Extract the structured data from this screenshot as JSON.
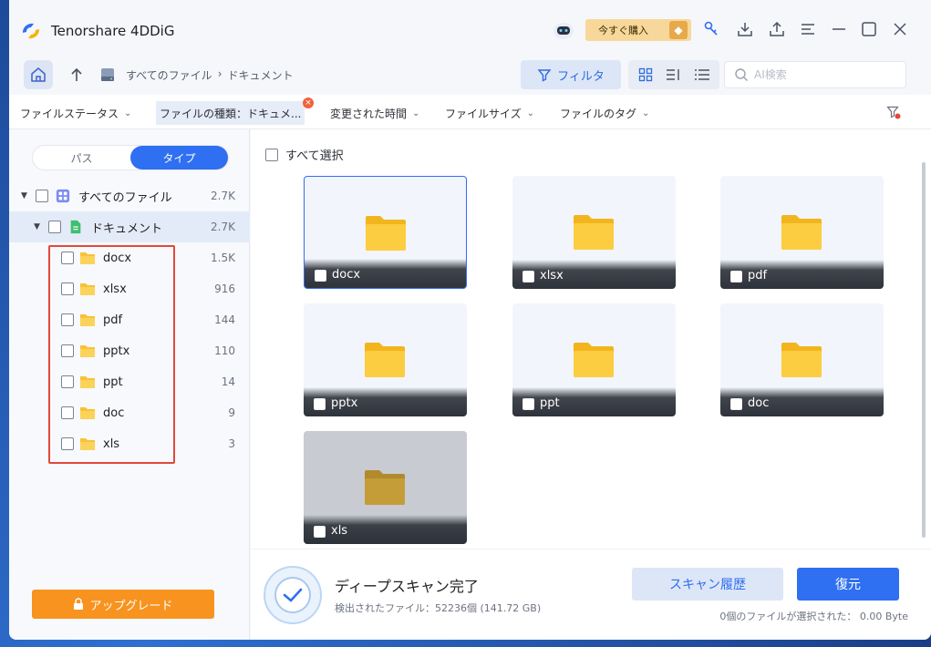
{
  "app": {
    "title": "Tenorshare 4DDiG",
    "buy_label": "今すぐ購入"
  },
  "nav": {
    "breadcrumb": [
      "すべてのファイル",
      "ドキュメント"
    ],
    "filter_label": "フィルタ",
    "search_placeholder": "AI検索"
  },
  "filters": [
    {
      "label": "ファイルステータス"
    },
    {
      "label": "ファイルの種類：ドキュメ..."
    },
    {
      "label": "変更された時間"
    },
    {
      "label": "ファイルサイズ"
    },
    {
      "label": "ファイルのタグ"
    }
  ],
  "sidebar": {
    "tabs": [
      "パス",
      "タイプ"
    ],
    "active_tab": "タイプ",
    "root": {
      "label": "すべてのファイル",
      "count": "2.7K"
    },
    "category": {
      "label": "ドキュメント",
      "count": "2.7K"
    },
    "items": [
      {
        "label": "docx",
        "count": "1.5K"
      },
      {
        "label": "xlsx",
        "count": "916"
      },
      {
        "label": "pdf",
        "count": "144"
      },
      {
        "label": "pptx",
        "count": "110"
      },
      {
        "label": "ppt",
        "count": "14"
      },
      {
        "label": "doc",
        "count": "9"
      },
      {
        "label": "xls",
        "count": "3"
      }
    ],
    "upgrade_label": "アップグレード"
  },
  "main": {
    "select_all_label": "すべて選択",
    "cards": [
      {
        "label": "docx"
      },
      {
        "label": "xlsx"
      },
      {
        "label": "pdf"
      },
      {
        "label": "pptx"
      },
      {
        "label": "ppt"
      },
      {
        "label": "doc"
      },
      {
        "label": "xls"
      }
    ]
  },
  "footer": {
    "title": "ディープスキャン完了",
    "subtitle": "検出されたファイル：52236個 (141.72 GB)",
    "history_label": "スキャン履歴",
    "recover_label": "復元",
    "selection_status": "0個のファイルが選択された：  0.00 Byte"
  },
  "colors": {
    "accent": "#2f6ff1",
    "upgrade": "#f7931e",
    "highlight": "#e2483a",
    "folder": "#f7c236"
  }
}
